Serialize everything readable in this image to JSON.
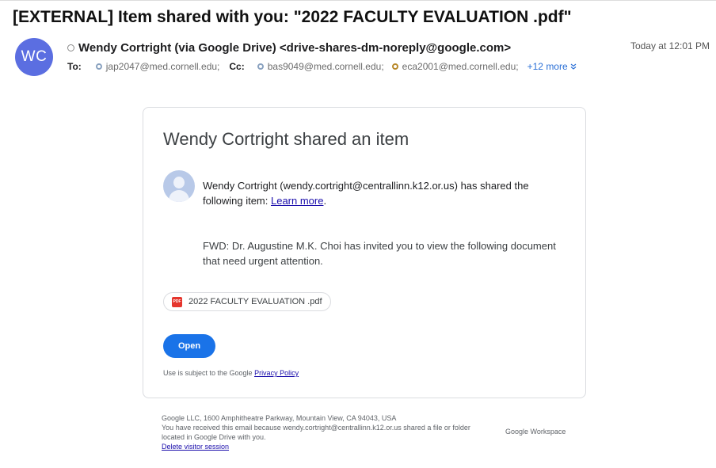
{
  "email": {
    "subject": "[EXTERNAL] Item shared with you: \"2022 FACULTY EVALUATION .pdf\"",
    "avatar_initials": "WC",
    "sender": "Wendy Cortright (via Google Drive) <drive-shares-dm-noreply@google.com>",
    "date": "Today at 12:01 PM",
    "to_label": "To:",
    "to_address": "jap2047@med.cornell.edu;",
    "cc_label": "Cc:",
    "cc_addresses": [
      "bas9049@med.cornell.edu;",
      "eca2001@med.cornell.edu;"
    ],
    "more_label": "+12 more",
    "colors": {
      "avatar": "#5b6ee1",
      "more_link": "#2a6fd6"
    }
  },
  "card": {
    "title": "Wendy Cortright shared an item",
    "share_message": "Wendy Cortright (wendy.cortright@centrallinn.k12.or.us) has shared the following item: ",
    "learn_more": "Learn more",
    "period": ".",
    "fwd_message": "FWD: Dr. Augustine M.K. Choi has invited you to view the following document that need urgent attention.",
    "file_name": "2022 FACULTY EVALUATION .pdf",
    "file_icon_label": "PDF",
    "open_label": "Open",
    "policy_prefix": "Use is subject to the Google ",
    "policy_link": "Privacy Policy",
    "colors": {
      "open_button": "#1a73e8",
      "pdf_icon": "#e5352d"
    }
  },
  "footer": {
    "address": "Google LLC, 1600 Amphitheatre Parkway, Mountain View, CA 94043, USA",
    "reason": "You have received this email because wendy.cortright@centrallinn.k12.or.us shared a file or folder located in Google Drive with you.",
    "delete_link": "Delete visitor session",
    "logo": "Google Workspace"
  }
}
